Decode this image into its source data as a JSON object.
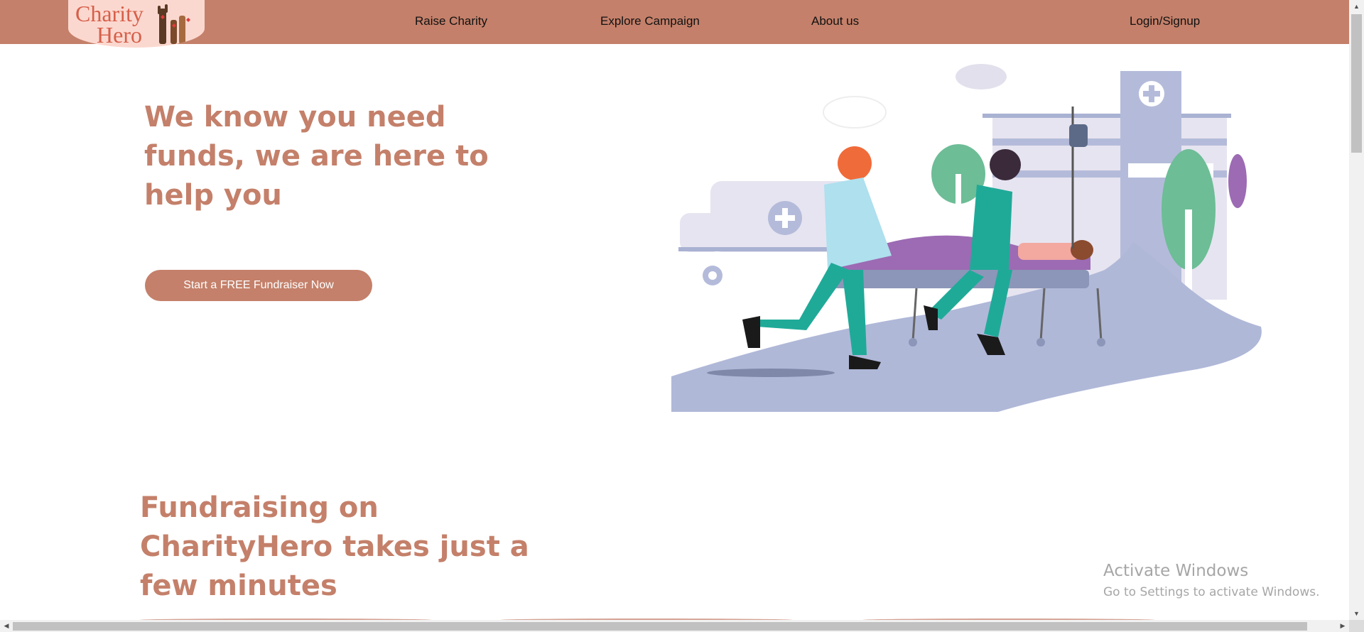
{
  "header": {
    "logo": {
      "line1": "Charity",
      "line2": "Hero"
    },
    "nav": {
      "raise": "Raise Charity",
      "explore": "Explore Campaign",
      "about": "About us",
      "login": "Login/Signup"
    }
  },
  "hero": {
    "title": "We know you need funds, we are here to help you",
    "cta": "Start a FREE Fundraiser Now",
    "illustration_icon": "hospital-emergency-illustration"
  },
  "section": {
    "title": "Fundraising on CharityHero takes just a few minutes"
  },
  "watermark": {
    "title": "Activate Windows",
    "subtitle": "Go to Settings to activate Windows."
  },
  "scrollbars": {
    "up": "▲",
    "down": "▼",
    "left": "◀",
    "right": "▶"
  },
  "colors": {
    "brand": "#c4806a",
    "logo_bg": "#fbd8cf",
    "illustration_ground": "#b0b8d8"
  }
}
